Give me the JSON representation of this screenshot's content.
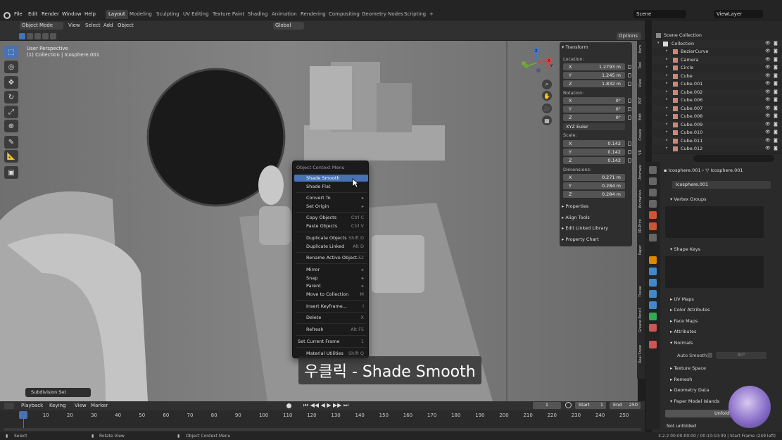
{
  "topbar": {
    "menus": [
      "File",
      "Edit",
      "Render",
      "Window",
      "Help"
    ],
    "workspaces": [
      "Layout",
      "Modeling",
      "Sculpting",
      "UV Editing",
      "Texture Paint",
      "Shading",
      "Animation",
      "Rendering",
      "Compositing",
      "Geometry Nodes",
      "Scripting"
    ],
    "active_workspace": "Layout",
    "add_tab": "+",
    "scene": "Scene",
    "view_layer": "ViewLayer"
  },
  "viewport_header": {
    "mode": "Object Mode",
    "menus": [
      "View",
      "Select",
      "Add",
      "Object"
    ],
    "transform_orientation": "Global",
    "options": "Options"
  },
  "viewport": {
    "perspective": "User Perspective",
    "collection_info": "(1) Collection | Icosphere.001",
    "last_op": "Subdivision Set",
    "gizmo_axes": [
      "X",
      "Y",
      "Z"
    ]
  },
  "npanel": {
    "section": "Transform",
    "location_label": "Location:",
    "location": [
      {
        "axis": "X",
        "val": "1.2793 m"
      },
      {
        "axis": "Y",
        "val": "1.245 m"
      },
      {
        "axis": "Z",
        "val": "1.832 m"
      }
    ],
    "rotation_label": "Rotation:",
    "rotation": [
      {
        "axis": "X",
        "val": "0°"
      },
      {
        "axis": "Y",
        "val": "0°"
      },
      {
        "axis": "Z",
        "val": "0°"
      }
    ],
    "rotation_mode": "XYZ Euler",
    "scale_label": "Scale:",
    "scale": [
      {
        "axis": "X",
        "val": "0.142"
      },
      {
        "axis": "Y",
        "val": "0.142"
      },
      {
        "axis": "Z",
        "val": "0.142"
      }
    ],
    "dimensions_label": "Dimensions:",
    "dimensions": [
      {
        "axis": "X",
        "val": "0.271 m"
      },
      {
        "axis": "Y",
        "val": "0.284 m"
      },
      {
        "axis": "Z",
        "val": "0.284 m"
      }
    ],
    "subpanels": [
      "Properties",
      "Align Tools",
      "Edit Linked Library",
      "Property Chart"
    ],
    "side_tabs": [
      "Item",
      "Tool",
      "View",
      "PDT",
      "Edit",
      "Create",
      "VR",
      "Animate",
      "Animation",
      "3D-Print",
      "Paper",
      "Tissue",
      "Grease Pencil",
      "Real Snow"
    ]
  },
  "context_menu": {
    "title": "Object Context Menu",
    "items": [
      {
        "label": "Shade Smooth",
        "shortcut": "",
        "highlight": true
      },
      {
        "label": "Shade Flat",
        "shortcut": ""
      },
      {
        "label": "Convert To",
        "shortcut": "▸"
      },
      {
        "label": "Set Origin",
        "shortcut": "▸"
      },
      {
        "label": "Copy Objects",
        "shortcut": "Ctrl C"
      },
      {
        "label": "Paste Objects",
        "shortcut": "Ctrl V"
      },
      {
        "label": "Duplicate Objects",
        "shortcut": "Shift D"
      },
      {
        "label": "Duplicate Linked",
        "shortcut": "Alt D"
      },
      {
        "label": "Rename Active Object...",
        "shortcut": "F2"
      },
      {
        "label": "Mirror",
        "shortcut": "▸"
      },
      {
        "label": "Snap",
        "shortcut": "▸"
      },
      {
        "label": "Parent",
        "shortcut": "▸"
      },
      {
        "label": "Move to Collection",
        "shortcut": "M"
      },
      {
        "label": "Insert Keyframe...",
        "shortcut": "I"
      },
      {
        "label": "Delete",
        "shortcut": "X"
      },
      {
        "label": "Refresh",
        "shortcut": "Alt F5"
      },
      {
        "label": "Set Current Frame",
        "shortcut": "1"
      },
      {
        "label": "Material Utilities",
        "shortcut": "Shift Q"
      }
    ]
  },
  "subtitle": "우클릭 - Shade Smooth",
  "outliner": {
    "root": "Scene Collection",
    "collection": "Collection",
    "objects": [
      "BezierCurve",
      "Camera",
      "Circle",
      "Cube",
      "Cube.001",
      "Cube.002",
      "Cube.006",
      "Cube.007",
      "Cube.008",
      "Cube.009",
      "Cube.010",
      "Cube.011",
      "Cube.012"
    ]
  },
  "properties": {
    "breadcrumb_object": "Icosphere.001",
    "breadcrumb_mesh": "Icosphere.001",
    "mesh_name": "Icosphere.001",
    "sections": [
      "Vertex Groups",
      "Shape Keys",
      "UV Maps",
      "Color Attributes",
      "Face Maps",
      "Attributes",
      "Normals",
      "Texture Space",
      "Remesh",
      "Geometry Data",
      "Paper Model Islands"
    ],
    "auto_smooth": "Auto Smooth",
    "auto_smooth_angle": "30°",
    "unfold_label": "Unfold",
    "not_unfolded": "Not unfolded"
  },
  "timeline": {
    "menus": [
      "Playback",
      "Keying",
      "View",
      "Marker"
    ],
    "current_frame": "1",
    "start_label": "Start",
    "start": "1",
    "end_label": "End",
    "end": "250",
    "ticks": [
      "1",
      "10",
      "20",
      "30",
      "40",
      "50",
      "60",
      "70",
      "80",
      "90",
      "100",
      "110",
      "120",
      "130",
      "140",
      "150",
      "160",
      "170",
      "180",
      "190",
      "200",
      "210",
      "220",
      "230",
      "240",
      "250"
    ]
  },
  "statusbar": {
    "select": "Select",
    "rotate": "Rotate View",
    "context": "Object Context Menu",
    "info": "3.2.2  00:00:00:00 / 00:10:10:09 | Start Frame (249 left)"
  }
}
